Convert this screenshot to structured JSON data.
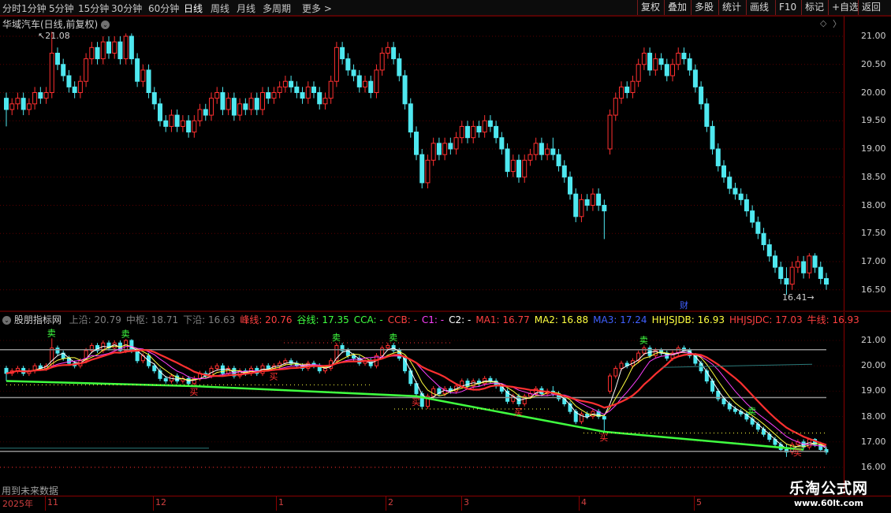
{
  "toolbar": {
    "periods": [
      "分时",
      "1分钟",
      "5分钟",
      "15分钟",
      "30分钟",
      "60分钟",
      "日线",
      "周线",
      "月线",
      "多周期",
      "更多 >"
    ],
    "active_period": "日线",
    "tools": [
      "复权",
      "叠加",
      "多股",
      "统计",
      "画线",
      "F10",
      "标记",
      "+自选",
      "返回"
    ]
  },
  "main_chart": {
    "title": "华域汽车(日线,前复权)",
    "high_marker": "21.08",
    "low_marker": "16.41",
    "price_ticks": [
      "21.00",
      "20.50",
      "20.00",
      "19.50",
      "19.00",
      "18.50",
      "18.00",
      "17.50",
      "17.00",
      "16.50"
    ],
    "news_marker": "财"
  },
  "indicator": {
    "name": "股朋指标网",
    "items": [
      {
        "label": "上沿:",
        "value": "20.79",
        "color": "#808080"
      },
      {
        "label": "中枢:",
        "value": "18.71",
        "color": "#808080"
      },
      {
        "label": "下沿:",
        "value": "16.63",
        "color": "#808080"
      },
      {
        "label": "峰线:",
        "value": "20.76",
        "color": "#ff4040"
      },
      {
        "label": "谷线:",
        "value": "17.35",
        "color": "#40ff40"
      },
      {
        "label": "CCA:",
        "value": "-",
        "color": "#40ff40"
      },
      {
        "label": "CCB:",
        "value": "-",
        "color": "#ff4040"
      },
      {
        "label": "C1:",
        "value": "-",
        "color": "#ff40ff"
      },
      {
        "label": "C2:",
        "value": "-",
        "color": "#ffffff"
      },
      {
        "label": "MA1:",
        "value": "16.77",
        "color": "#ff4040"
      },
      {
        "label": "MA2:",
        "value": "16.88",
        "color": "#ffff40"
      },
      {
        "label": "MA3:",
        "value": "17.24",
        "color": "#4060ff"
      },
      {
        "label": "HHJSJDB:",
        "value": "16.93",
        "color": "#ffff40"
      },
      {
        "label": "HHJSJDC:",
        "value": "17.03",
        "color": "#ff4040"
      },
      {
        "label": "牛线:",
        "value": "16.93",
        "color": "#ff4040"
      }
    ],
    "ticks": [
      "21.00",
      "20.00",
      "19.00",
      "18.00",
      "17.00",
      "16.00"
    ],
    "sell_marker": "卖",
    "buy_marker": "买",
    "future_note": "用到未来数据"
  },
  "date_axis": {
    "year": "2025年",
    "months": [
      "11",
      "12",
      "1",
      "2",
      "3",
      "4",
      "5"
    ]
  },
  "watermark": {
    "line1": "乐淘公式网",
    "line2": "www.60lt.com"
  },
  "chart_data": {
    "type": "candlestick",
    "title": "华域汽车(日线,前复权)",
    "ylim": [
      16.3,
      21.3
    ],
    "up_color": "#ff3030",
    "down_color": "#4fe8f0",
    "candles": [
      [
        19.9,
        19.7,
        20.0,
        19.4
      ],
      [
        19.7,
        19.8,
        19.9,
        19.6
      ],
      [
        19.8,
        19.9,
        20.0,
        19.7
      ],
      [
        19.9,
        19.7,
        20.0,
        19.6
      ],
      [
        19.7,
        19.8,
        19.9,
        19.6
      ],
      [
        19.8,
        20.0,
        20.1,
        19.7
      ],
      [
        20.0,
        19.9,
        20.1,
        19.8
      ],
      [
        19.9,
        20.0,
        20.1,
        19.8
      ],
      [
        20.0,
        20.7,
        21.08,
        19.9
      ],
      [
        20.7,
        20.5,
        20.8,
        20.4
      ],
      [
        20.5,
        20.3,
        20.6,
        20.2
      ],
      [
        20.3,
        20.1,
        20.4,
        20.0
      ],
      [
        20.1,
        20.0,
        20.2,
        19.9
      ],
      [
        20.0,
        20.2,
        20.3,
        19.9
      ],
      [
        20.2,
        20.6,
        20.7,
        20.1
      ],
      [
        20.6,
        20.8,
        20.9,
        20.5
      ],
      [
        20.8,
        20.6,
        20.9,
        20.5
      ],
      [
        20.6,
        20.9,
        21.0,
        20.5
      ],
      [
        20.9,
        20.7,
        21.0,
        20.6
      ],
      [
        20.7,
        20.9,
        21.0,
        20.6
      ],
      [
        20.9,
        20.6,
        21.0,
        20.5
      ],
      [
        20.6,
        21.0,
        21.05,
        20.5
      ],
      [
        21.0,
        20.6,
        21.05,
        20.5
      ],
      [
        20.6,
        20.2,
        20.7,
        20.1
      ],
      [
        20.2,
        20.4,
        20.5,
        20.1
      ],
      [
        20.4,
        20.0,
        20.5,
        19.9
      ],
      [
        20.0,
        19.8,
        20.1,
        19.7
      ],
      [
        19.8,
        19.5,
        19.9,
        19.4
      ],
      [
        19.5,
        19.4,
        19.6,
        19.3
      ],
      [
        19.4,
        19.6,
        19.7,
        19.3
      ],
      [
        19.6,
        19.4,
        19.7,
        19.3
      ],
      [
        19.4,
        19.5,
        19.6,
        19.3
      ],
      [
        19.5,
        19.3,
        19.6,
        19.2
      ],
      [
        19.3,
        19.5,
        19.6,
        19.2
      ],
      [
        19.5,
        19.7,
        19.8,
        19.4
      ],
      [
        19.7,
        19.6,
        19.8,
        19.5
      ],
      [
        19.6,
        19.9,
        20.0,
        19.5
      ],
      [
        19.9,
        20.0,
        20.1,
        19.8
      ],
      [
        20.0,
        19.7,
        20.1,
        19.6
      ],
      [
        19.7,
        19.9,
        20.0,
        19.6
      ],
      [
        19.9,
        19.6,
        20.0,
        19.5
      ],
      [
        19.6,
        19.8,
        19.9,
        19.5
      ],
      [
        19.8,
        19.7,
        19.9,
        19.6
      ],
      [
        19.7,
        19.9,
        20.0,
        19.6
      ],
      [
        19.9,
        19.7,
        20.0,
        19.6
      ],
      [
        19.7,
        20.0,
        20.1,
        19.6
      ],
      [
        20.0,
        19.9,
        20.1,
        19.8
      ],
      [
        19.9,
        20.0,
        20.1,
        19.8
      ],
      [
        20.0,
        20.1,
        20.2,
        19.9
      ],
      [
        20.1,
        20.2,
        20.3,
        20.0
      ],
      [
        20.2,
        20.1,
        20.3,
        20.0
      ],
      [
        20.1,
        20.0,
        20.2,
        19.9
      ],
      [
        20.0,
        19.9,
        20.1,
        19.8
      ],
      [
        19.9,
        20.1,
        20.2,
        19.8
      ],
      [
        20.1,
        20.0,
        20.2,
        19.9
      ],
      [
        20.0,
        19.8,
        20.1,
        19.7
      ],
      [
        19.8,
        19.9,
        20.0,
        19.7
      ],
      [
        19.9,
        20.2,
        20.3,
        19.8
      ],
      [
        20.2,
        20.8,
        20.9,
        20.1
      ],
      [
        20.8,
        20.6,
        20.9,
        20.5
      ],
      [
        20.6,
        20.4,
        20.7,
        20.3
      ],
      [
        20.4,
        20.3,
        20.5,
        20.2
      ],
      [
        20.3,
        20.1,
        20.4,
        20.0
      ],
      [
        20.1,
        20.2,
        20.3,
        20.0
      ],
      [
        20.2,
        20.0,
        20.3,
        19.9
      ],
      [
        20.0,
        20.4,
        20.5,
        19.9
      ],
      [
        20.4,
        20.7,
        20.8,
        20.3
      ],
      [
        20.7,
        20.8,
        20.9,
        20.6
      ],
      [
        20.8,
        20.6,
        20.9,
        20.5
      ],
      [
        20.6,
        20.3,
        20.7,
        20.2
      ],
      [
        20.3,
        19.8,
        20.4,
        19.7
      ],
      [
        19.8,
        19.3,
        19.9,
        19.2
      ],
      [
        19.3,
        18.9,
        19.4,
        18.8
      ],
      [
        18.9,
        18.4,
        19.0,
        18.3
      ],
      [
        18.4,
        18.8,
        18.9,
        18.3
      ],
      [
        18.8,
        19.1,
        19.2,
        18.7
      ],
      [
        19.1,
        18.9,
        19.2,
        18.8
      ],
      [
        18.9,
        19.1,
        19.2,
        18.8
      ],
      [
        19.1,
        19.0,
        19.2,
        18.9
      ],
      [
        19.0,
        19.2,
        19.3,
        18.9
      ],
      [
        19.2,
        19.4,
        19.5,
        19.1
      ],
      [
        19.4,
        19.2,
        19.5,
        19.1
      ],
      [
        19.2,
        19.4,
        19.5,
        19.1
      ],
      [
        19.4,
        19.3,
        19.5,
        19.2
      ],
      [
        19.3,
        19.5,
        19.6,
        19.2
      ],
      [
        19.5,
        19.4,
        19.6,
        19.3
      ],
      [
        19.4,
        19.2,
        19.5,
        19.1
      ],
      [
        19.2,
        19.0,
        19.3,
        18.9
      ],
      [
        19.0,
        18.6,
        19.1,
        18.5
      ],
      [
        18.6,
        18.8,
        18.9,
        18.5
      ],
      [
        18.8,
        18.5,
        18.9,
        18.4
      ],
      [
        18.5,
        18.8,
        18.9,
        18.4
      ],
      [
        18.8,
        18.9,
        19.0,
        18.7
      ],
      [
        18.9,
        19.1,
        19.2,
        18.8
      ],
      [
        19.1,
        18.9,
        19.2,
        18.8
      ],
      [
        18.9,
        19.0,
        19.1,
        18.8
      ],
      [
        19.0,
        18.9,
        19.2,
        18.8
      ],
      [
        18.9,
        18.7,
        19.0,
        18.6
      ],
      [
        18.7,
        18.5,
        18.8,
        18.4
      ],
      [
        18.5,
        18.2,
        18.6,
        18.1
      ],
      [
        18.2,
        17.8,
        18.3,
        17.7
      ],
      [
        17.8,
        18.1,
        18.2,
        17.7
      ],
      [
        18.1,
        18.0,
        18.2,
        17.9
      ],
      [
        18.0,
        18.2,
        18.3,
        17.9
      ],
      [
        18.2,
        18.0,
        18.3,
        17.9
      ],
      [
        18.0,
        17.9,
        18.1,
        17.4
      ],
      [
        19.0,
        19.6,
        19.7,
        18.9
      ],
      [
        19.6,
        19.9,
        20.0,
        19.5
      ],
      [
        19.9,
        20.1,
        20.2,
        19.8
      ],
      [
        20.1,
        20.0,
        20.2,
        19.9
      ],
      [
        20.0,
        20.2,
        20.3,
        19.9
      ],
      [
        20.2,
        20.5,
        20.6,
        20.1
      ],
      [
        20.5,
        20.7,
        20.8,
        20.4
      ],
      [
        20.7,
        20.4,
        20.8,
        20.3
      ],
      [
        20.4,
        20.6,
        20.7,
        20.3
      ],
      [
        20.6,
        20.5,
        20.7,
        20.4
      ],
      [
        20.5,
        20.3,
        20.6,
        20.2
      ],
      [
        20.3,
        20.5,
        20.6,
        20.2
      ],
      [
        20.5,
        20.7,
        20.8,
        20.4
      ],
      [
        20.7,
        20.6,
        20.8,
        20.5
      ],
      [
        20.6,
        20.4,
        20.7,
        20.3
      ],
      [
        20.4,
        20.1,
        20.5,
        20.0
      ],
      [
        20.1,
        19.8,
        20.2,
        19.7
      ],
      [
        19.8,
        19.4,
        19.9,
        19.3
      ],
      [
        19.4,
        19.0,
        19.5,
        18.9
      ],
      [
        19.0,
        18.7,
        19.1,
        18.6
      ],
      [
        18.7,
        18.5,
        18.8,
        18.4
      ],
      [
        18.5,
        18.3,
        18.6,
        18.2
      ],
      [
        18.3,
        18.2,
        18.4,
        18.1
      ],
      [
        18.2,
        18.1,
        18.3,
        18.0
      ],
      [
        18.1,
        17.9,
        18.2,
        17.8
      ],
      [
        17.9,
        17.7,
        18.0,
        17.6
      ],
      [
        17.7,
        17.5,
        17.8,
        17.4
      ],
      [
        17.5,
        17.3,
        17.6,
        17.2
      ],
      [
        17.3,
        17.1,
        17.4,
        17.0
      ],
      [
        17.1,
        16.9,
        17.2,
        16.8
      ],
      [
        16.9,
        16.7,
        17.0,
        16.6
      ],
      [
        16.7,
        16.6,
        16.9,
        16.41
      ],
      [
        16.6,
        16.9,
        17.0,
        16.5
      ],
      [
        16.9,
        17.0,
        17.1,
        16.8
      ],
      [
        17.0,
        16.8,
        17.1,
        16.7
      ],
      [
        16.8,
        17.1,
        17.15,
        16.7
      ],
      [
        17.1,
        16.9,
        17.15,
        16.8
      ],
      [
        16.9,
        16.7,
        17.0,
        16.6
      ],
      [
        16.7,
        16.6,
        16.8,
        16.5
      ]
    ],
    "indicator_lines": {
      "upper_band": 20.79,
      "middle": 18.71,
      "lower_band": 16.63,
      "peak_line": 20.76,
      "valley_line": 17.35
    }
  }
}
